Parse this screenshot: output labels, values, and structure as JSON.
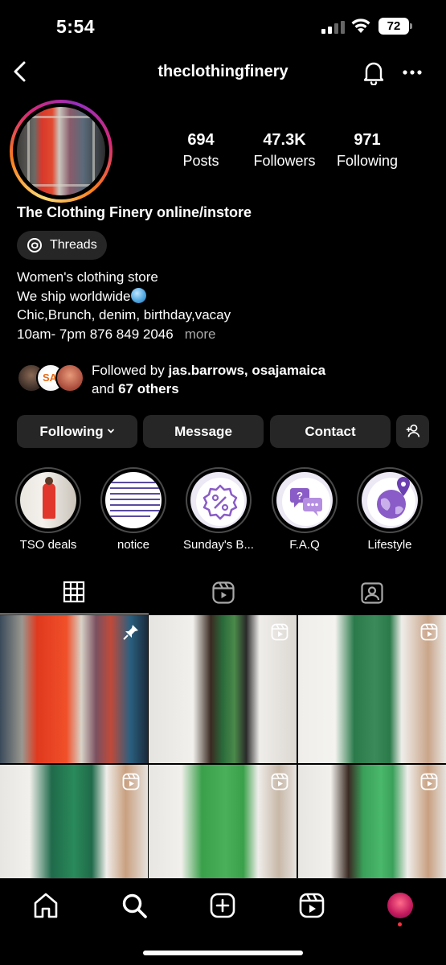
{
  "status_bar": {
    "time": "5:54",
    "battery": "72"
  },
  "header": {
    "username": "theclothingfinery"
  },
  "stats": [
    {
      "value": "694",
      "label": "Posts"
    },
    {
      "value": "47.3K",
      "label": "Followers"
    },
    {
      "value": "971",
      "label": "Following"
    }
  ],
  "profile": {
    "display_name": "The Clothing Finery online/instore",
    "threads_label": "Threads",
    "bio": {
      "line1": "Women's clothing store",
      "line2": "We ship worldwide",
      "line3": "Chic,Brunch, denim, birthday,vacay",
      "line4": "10am- 7pm 876 849 2046",
      "more": "more"
    }
  },
  "followed_by": {
    "prefix": "Followed by ",
    "users": "jas.barrows, osajamaica",
    "and": "and ",
    "others": "67 others"
  },
  "buttons": {
    "following": "Following",
    "message": "Message",
    "contact": "Contact"
  },
  "highlights": [
    {
      "label": "TSO deals"
    },
    {
      "label": "notice"
    },
    {
      "label": "Sunday's B..."
    },
    {
      "label": "F.A.Q"
    },
    {
      "label": "Lifestyle"
    }
  ],
  "tabs": [
    "grid-icon",
    "reels-icon",
    "tagged-icon"
  ],
  "colors": {
    "background": "#000000",
    "button": "#262626",
    "muted": "#a8a8a8",
    "notification_dot": "#ff3040",
    "highlight_purple": "#8a5cc7"
  }
}
